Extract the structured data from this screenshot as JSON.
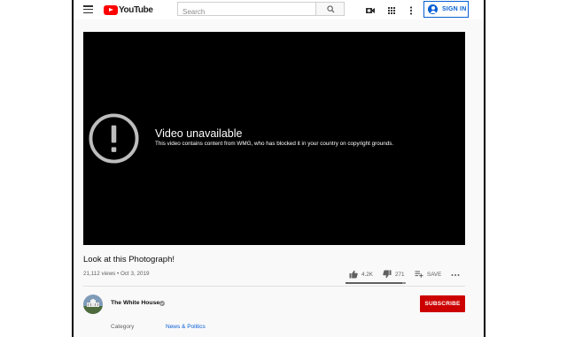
{
  "header": {
    "logo_text": "YouTube",
    "search_placeholder": "Search",
    "signin_label": "SIGN IN",
    "icons": [
      "menu-icon",
      "search-icon",
      "video-camera-icon",
      "apps-grid-icon",
      "more-vertical-icon",
      "account-icon"
    ]
  },
  "player": {
    "error_title": "Video unavailable",
    "error_message": "This video contains content from WMG, who has blocked it in your country on copyright grounds."
  },
  "video": {
    "title": "Look at this Photograph!",
    "meta": "21,112 views • Oct 3, 2019",
    "likes": "4.2K",
    "dislikes": "271",
    "save_label": "SAVE",
    "like_ratio": 0.94
  },
  "channel": {
    "name": "The White House",
    "subscribe_label": "SUBSCRIBE"
  },
  "details": {
    "category_label": "Category",
    "category_value": "News & Politics"
  },
  "colors": {
    "brand_red": "#ff0000",
    "subscribe_red": "#cc0000",
    "link_blue": "#065fd4",
    "player_bg": "#000000"
  }
}
